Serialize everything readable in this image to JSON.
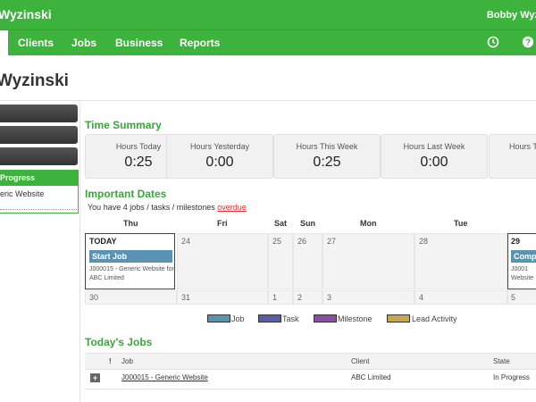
{
  "header": {
    "brand": "Wyzinski",
    "user": "Bobby Wyz"
  },
  "nav": {
    "items": [
      "Clients",
      "Jobs",
      "Business",
      "Reports"
    ],
    "icons": [
      "clock-icon",
      "help-icon"
    ]
  },
  "page": {
    "title": "Wyzinski"
  },
  "sidebar": {
    "panel_title": "Progress",
    "panel_link": "eric Website"
  },
  "time_summary": {
    "title": "Time Summary",
    "cards": [
      {
        "label": "Hours Today",
        "value": "0:25"
      },
      {
        "label": "Hours Yesterday",
        "value": "0:00"
      },
      {
        "label": "Hours This Week",
        "value": "0:25"
      },
      {
        "label": "Hours Last Week",
        "value": "0:00"
      },
      {
        "label": "Hours T",
        "value": ""
      }
    ]
  },
  "important_dates": {
    "title": "Important Dates",
    "message_prefix": "You have 4 jobs / tasks / milestones",
    "message_link": "overdue",
    "day_headers": [
      "Thu",
      "Fri",
      "Sat",
      "Sun",
      "Mon",
      "Tue"
    ],
    "week1": [
      "TODAY",
      "24",
      "25",
      "26",
      "27",
      "28",
      "29"
    ],
    "week2": [
      "30",
      "31",
      "1",
      "2",
      "3",
      "4",
      "5"
    ],
    "today_job": {
      "label": "Start Job",
      "text": "J000015 - Generic Website for ABC Limited"
    },
    "day29_job": {
      "label": "Comp",
      "text": "J0001 Website"
    },
    "legend": [
      {
        "label": "Job",
        "color": "#5a93b2"
      },
      {
        "label": "Task",
        "color": "#5b5ea6"
      },
      {
        "label": "Milestone",
        "color": "#8a4fa0"
      },
      {
        "label": "Lead Activity",
        "color": "#c8a64a"
      }
    ]
  },
  "todays_jobs": {
    "title": "Today's Jobs",
    "columns": [
      "!",
      "Job",
      "Client",
      "State"
    ],
    "rows": [
      {
        "job": "J000015 - Generic Website",
        "client": "ABC Limited",
        "state": "In Progress"
      }
    ]
  }
}
